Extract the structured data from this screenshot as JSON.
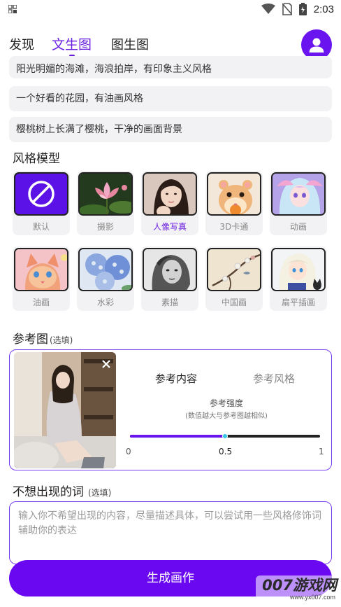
{
  "status_bar": {
    "time": "2:03"
  },
  "tabs": [
    {
      "label": "发现"
    },
    {
      "label": "文生图"
    },
    {
      "label": "图生图"
    }
  ],
  "active_tab": "文生图",
  "colors": {
    "accent": "#6a14f0",
    "slider_thumb": "#32c6e6"
  },
  "prompts": [
    "阳光明媚的海滩，海浪拍岸，有印象主义风格",
    "一个好看的花园，有油画风格",
    "樱桃树上长满了樱桃，干净的画面背景"
  ],
  "style_section": {
    "title": "风格模型"
  },
  "styles": [
    {
      "label": "默认",
      "icon": "ban-icon"
    },
    {
      "label": "摄影"
    },
    {
      "label": "人像写真",
      "selected": true
    },
    {
      "label": "3D卡通"
    },
    {
      "label": "动画"
    },
    {
      "label": "油画"
    },
    {
      "label": "水彩"
    },
    {
      "label": "素描"
    },
    {
      "label": "中国画"
    },
    {
      "label": "扁平插画"
    }
  ],
  "reference": {
    "title": "参考图",
    "hint": "(选填)",
    "tab_content": "参考内容",
    "tab_style": "参考风格",
    "strength_title": "参考强度",
    "strength_sub": "(数值越大与参考图越相似)",
    "min": "0",
    "mid": "0.5",
    "max": "1",
    "value": 0.5
  },
  "negative": {
    "title": "不想出现的词",
    "hint": "(选填)",
    "placeholder": "输入你不希望出现的内容，尽量描述具体，可以尝试用一些风格修饰词辅助你的表达"
  },
  "generate_button": "生成画作",
  "watermark": {
    "text": "007游戏网",
    "sub": "www.yx007.com"
  }
}
